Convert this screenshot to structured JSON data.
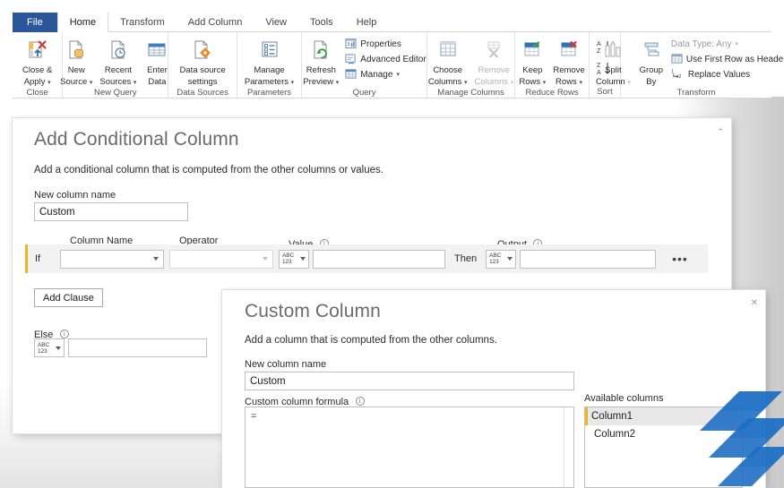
{
  "app": {
    "ribbon": {
      "tabs": [
        {
          "id": "file",
          "label": "File"
        },
        {
          "id": "home",
          "label": "Home"
        },
        {
          "id": "transform",
          "label": "Transform"
        },
        {
          "id": "add-column",
          "label": "Add Column"
        },
        {
          "id": "view",
          "label": "View"
        },
        {
          "id": "tools",
          "label": "Tools"
        },
        {
          "id": "help",
          "label": "Help"
        }
      ],
      "active_tab": "Home",
      "groups": [
        {
          "name": "Close",
          "label": "Close",
          "buttons": [
            {
              "label_line1": "Close &",
              "label_line2": "Apply",
              "icon": "close-apply-icon",
              "dropdown": true
            }
          ]
        },
        {
          "name": "New Query",
          "label": "New Query",
          "buttons": [
            {
              "label_line1": "New",
              "label_line2": "Source",
              "icon": "new-source-icon",
              "dropdown": true
            },
            {
              "label_line1": "Recent",
              "label_line2": "Sources",
              "icon": "recent-sources-icon",
              "dropdown": true
            },
            {
              "label_line1": "Enter",
              "label_line2": "Data",
              "icon": "enter-data-icon",
              "dropdown": false
            }
          ]
        },
        {
          "name": "Data Sources",
          "label": "Data Sources",
          "buttons": [
            {
              "label_line1": "Data source",
              "label_line2": "settings",
              "icon": "data-source-settings-icon",
              "dropdown": false
            }
          ]
        },
        {
          "name": "Parameters",
          "label": "Parameters",
          "buttons": [
            {
              "label_line1": "Manage",
              "label_line2": "Parameters",
              "icon": "manage-parameters-icon",
              "dropdown": true
            }
          ]
        },
        {
          "name": "Query",
          "label": "Query",
          "buttons": [
            {
              "label_line1": "Refresh",
              "label_line2": "Preview",
              "icon": "refresh-preview-icon",
              "dropdown": true
            }
          ],
          "small_buttons": [
            {
              "label": "Properties",
              "icon": "properties-icon",
              "dropdown": false
            },
            {
              "label": "Advanced Editor",
              "icon": "advanced-editor-icon",
              "dropdown": false
            },
            {
              "label": "Manage",
              "icon": "manage-icon",
              "dropdown": true
            }
          ]
        },
        {
          "name": "Manage Columns",
          "label": "Manage Columns",
          "buttons": [
            {
              "label_line1": "Choose",
              "label_line2": "Columns",
              "icon": "choose-columns-icon",
              "dropdown": true,
              "disabled": false
            },
            {
              "label_line1": "Remove",
              "label_line2": "Columns",
              "icon": "remove-columns-icon",
              "dropdown": true,
              "disabled": true
            }
          ]
        },
        {
          "name": "Reduce Rows",
          "label": "Reduce Rows",
          "buttons": [
            {
              "label_line1": "Keep",
              "label_line2": "Rows",
              "icon": "keep-rows-icon",
              "dropdown": true
            },
            {
              "label_line1": "Remove",
              "label_line2": "Rows",
              "icon": "remove-rows-icon",
              "dropdown": true
            }
          ]
        },
        {
          "name": "Sort",
          "label": "Sort",
          "buttons": [
            {
              "label_line1": "",
              "label_line2": "",
              "icon": "sort-ascending-icon",
              "dropdown": false
            },
            {
              "label_line1": "",
              "label_line2": "",
              "icon": "sort-descending-icon",
              "dropdown": false
            }
          ]
        },
        {
          "name": "Transform",
          "label": "Transform",
          "buttons": [
            {
              "label_line1": "Split",
              "label_line2": "Column",
              "icon": "split-column-icon",
              "dropdown": true,
              "disabled": true
            },
            {
              "label_line1": "Group",
              "label_line2": "By",
              "icon": "group-by-icon",
              "dropdown": false
            }
          ],
          "small_buttons": [
            {
              "label": "Data Type: Any",
              "icon": "data-type-icon",
              "dropdown": true,
              "disabled": true
            },
            {
              "label": "Use First Row as Headers",
              "icon": "use-first-row-headers-icon",
              "dropdown": true
            },
            {
              "label": "Replace Values",
              "icon": "replace-values-icon",
              "dropdown": false
            }
          ]
        }
      ]
    }
  },
  "conditional_dialog": {
    "title": "Add Conditional Column",
    "subtitle": "Add a conditional column that is computed from the other columns or values.",
    "new_column_name_label": "New column name",
    "new_column_name_value": "Custom",
    "headers": {
      "column_name": "Column Name",
      "operator": "Operator",
      "value": "Value",
      "output": "Output"
    },
    "clause": {
      "if_label": "If",
      "then_label": "Then",
      "column_name_value": "",
      "operator_value": "",
      "value_type": "ABC123",
      "value_text": "",
      "output_type": "ABC123",
      "output_text": "",
      "more_label": "•••"
    },
    "add_clause_label": "Add Clause",
    "else_label": "Else",
    "else_type": "ABC123",
    "else_text": "",
    "collapse_icon": "chevron-up-icon"
  },
  "custom_dialog": {
    "title": "Custom Column",
    "subtitle": "Add a column that is computed from the other columns.",
    "new_column_name_label": "New column name",
    "new_column_name_value": "Custom",
    "formula_label": "Custom column formula",
    "formula_value": "=",
    "available_columns_label": "Available columns",
    "available_columns": [
      {
        "name": "Column1",
        "selected": true
      },
      {
        "name": "Column2",
        "selected": false
      }
    ],
    "close_icon": "close-icon"
  },
  "colors": {
    "file_tab_blue": "#2b579a",
    "clause_accent": "#f0b323",
    "brand_blue": "#1f6fc4",
    "dialog_title_grey": "#6b6b6b",
    "row_bg": "#f2f2f2"
  }
}
